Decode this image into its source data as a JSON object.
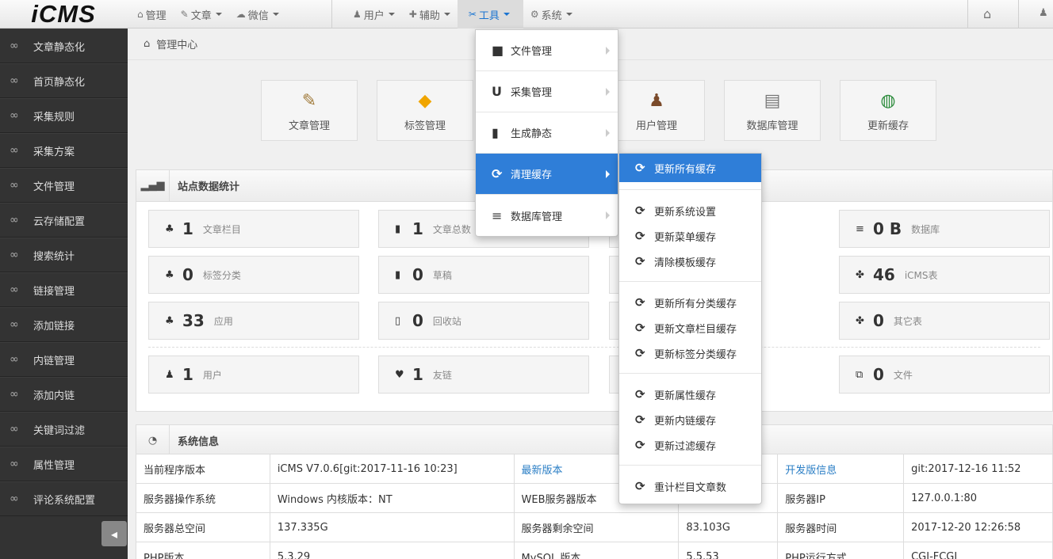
{
  "logo": "iCMS",
  "topnav": [
    {
      "icon": "home-icon",
      "glyph": "⌂",
      "label": "管理",
      "caret": false
    },
    {
      "icon": "edit-icon",
      "glyph": "✎",
      "label": "文章",
      "caret": true
    },
    {
      "icon": "wechat-icon",
      "glyph": "☁",
      "label": "微信",
      "caret": true
    },
    {
      "icon": "user-icon",
      "glyph": "♟",
      "label": "用户",
      "caret": true
    },
    {
      "icon": "wrench-icon",
      "glyph": "✚",
      "label": "辅助",
      "caret": true
    },
    {
      "icon": "tools-icon",
      "glyph": "✂",
      "label": "工具",
      "caret": true
    },
    {
      "icon": "gear-icon",
      "glyph": "⚙",
      "label": "系统",
      "caret": true
    }
  ],
  "sidebar": [
    {
      "label": "文章静态化"
    },
    {
      "label": "首页静态化"
    },
    {
      "label": "采集规则"
    },
    {
      "label": "采集方案"
    },
    {
      "label": "文件管理"
    },
    {
      "label": "云存储配置"
    },
    {
      "label": "搜索统计"
    },
    {
      "label": "链接管理"
    },
    {
      "label": "添加链接"
    },
    {
      "label": "内链管理"
    },
    {
      "label": "添加内链"
    },
    {
      "label": "关键词过滤"
    },
    {
      "label": "属性管理"
    },
    {
      "label": "评论系统配置"
    }
  ],
  "breadcrumb": "管理中心",
  "shortcuts": [
    {
      "label": "文章管理",
      "icon": "article-icon"
    },
    {
      "label": "标签管理",
      "icon": "tag-icon"
    },
    {
      "label": "",
      "icon": "hidden-icon"
    },
    {
      "label": "用户管理",
      "icon": "users-icon"
    },
    {
      "label": "数据库管理",
      "icon": "database-icon"
    },
    {
      "label": "更新缓存",
      "icon": "globe-icon"
    }
  ],
  "stats_panel": {
    "title": "站点数据统计",
    "items": [
      {
        "num": "1",
        "label": "文章栏目",
        "icon": "sitemap-icon"
      },
      {
        "num": "1",
        "label": "文章总数",
        "icon": "file-icon"
      },
      {
        "num": "0 B",
        "label": "数据库",
        "icon": "database-icon"
      },
      {
        "num": "0",
        "label": "标签分类",
        "icon": "sitemap-icon"
      },
      {
        "num": "0",
        "label": "草稿",
        "icon": "file-icon"
      },
      {
        "num": "46",
        "label": "iCMS表",
        "icon": "puzzle-icon"
      },
      {
        "num": "33",
        "label": "应用",
        "icon": "sitemap-icon"
      },
      {
        "num": "0",
        "label": "回收站",
        "icon": "file-outline-icon"
      },
      {
        "num": "0",
        "label": "其它表",
        "icon": "puzzle-icon"
      },
      {
        "num": "1",
        "label": "用户",
        "icon": "user-icon"
      },
      {
        "num": "1",
        "label": "友链",
        "icon": "heart-icon"
      },
      {
        "num": "0",
        "label": "文件",
        "icon": "files-icon"
      }
    ]
  },
  "system_panel": {
    "title": "系统信息",
    "rows": [
      [
        "当前程序版本",
        "iCMS V7.0.6[git:2017-11-16 10:23]",
        "最新版本",
        "",
        "开发版信息",
        "git:2017-12-16 11:52"
      ],
      [
        "服务器操作系统",
        "Windows  内核版本：NT",
        "WEB服务器版本",
        "",
        "服务器IP",
        "127.0.0.1:80"
      ],
      [
        "服务器总空间",
        "137.335G",
        "服务器剩余空间",
        "83.103G",
        "服务器时间",
        "2017-12-20 12:26:58"
      ],
      [
        "PHP版本",
        "5.3.29",
        "MySQL 版本",
        "5.5.53",
        "PHP运行方式",
        "CGI-FCGI"
      ]
    ]
  },
  "tools_menu": [
    {
      "label": "文件管理",
      "icon": "folder-icon",
      "glyph": "■"
    },
    {
      "label": "采集管理",
      "icon": "magnet-icon",
      "glyph": "U"
    },
    {
      "label": "生成静态",
      "icon": "file-icon",
      "glyph": "▮"
    },
    {
      "label": "清理缓存",
      "icon": "refresh-icon",
      "glyph": "⟳"
    },
    {
      "label": "数据库管理",
      "icon": "database-icon",
      "glyph": "≡"
    }
  ],
  "cache_submenu": [
    [
      "更新所有缓存"
    ],
    [
      "更新系统设置",
      "更新菜单缓存",
      "清除模板缓存"
    ],
    [
      "更新所有分类缓存",
      "更新文章栏目缓存",
      "更新标签分类缓存"
    ],
    [
      "更新属性缓存",
      "更新内链缓存",
      "更新过滤缓存"
    ],
    [
      "重计栏目文章数"
    ]
  ]
}
